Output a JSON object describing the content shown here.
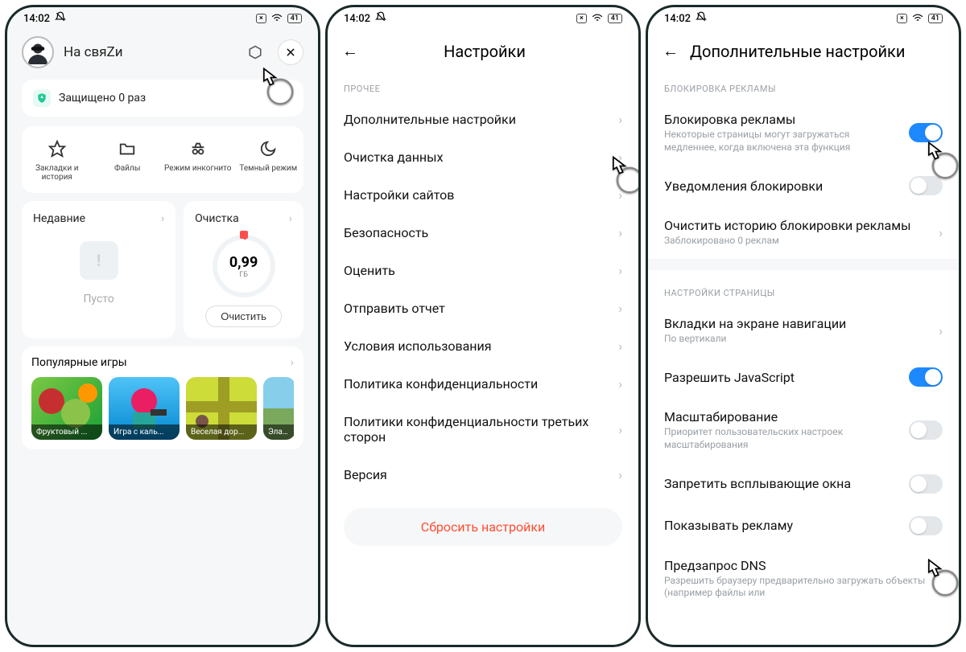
{
  "statusbar": {
    "time": "14:02",
    "battery": "41"
  },
  "phone1": {
    "username": "На свяZи",
    "protected": "Защищено 0 раз",
    "tiles": {
      "bookmarks": "Закладки и история",
      "files": "Файлы",
      "incognito": "Режим инкогнито",
      "dark": "Темный режим"
    },
    "recent": {
      "title": "Недавние",
      "empty": "Пусто"
    },
    "clean": {
      "title": "Очистка",
      "value": "0,99",
      "unit": "ГБ",
      "action": "Очистить"
    },
    "games": {
      "title": "Популярные игры",
      "items": [
        {
          "label": "Фруктовый ..."
        },
        {
          "label": "Игра с каль..."
        },
        {
          "label": "Веселая дор..."
        },
        {
          "label": "Элас..."
        }
      ]
    }
  },
  "phone2": {
    "title": "Настройки",
    "section": "ПРОЧЕЕ",
    "items": {
      "additional": "Дополнительные настройки",
      "clear_data": "Очистка данных",
      "site_settings": "Настройки сайтов",
      "security": "Безопасность",
      "rate": "Оценить",
      "report": "Отправить отчет",
      "terms": "Условия использования",
      "privacy": "Политика конфиденциальности",
      "third_party": "Политики конфиденциальности третьих сторон",
      "version": "Версия"
    },
    "reset": "Сбросить настройки"
  },
  "phone3": {
    "title": "Дополнительные настройки",
    "section_ads": "БЛОКИРОВКА РЕКЛАМЫ",
    "adblock": {
      "title": "Блокировка рекламы",
      "sub": "Некоторые страницы могут загружаться медленнее, когда включена эта функция"
    },
    "notif": "Уведомления блокировки",
    "clear_history": {
      "title": "Очистить историю блокировки рекламы",
      "sub": "Заблокировано 0 реклам"
    },
    "section_page": "НАСТРОЙКИ СТРАНИЦЫ",
    "tabs_nav": {
      "title": "Вкладки на экране навигации",
      "sub": "По вертикали"
    },
    "javascript": "Разрешить JavaScript",
    "zoom": {
      "title": "Масштабирование",
      "sub": "Приоритет пользовательских настроек масштабирования"
    },
    "popups": "Запретить всплывающие окна",
    "show_ads": "Показывать рекламу",
    "dns": {
      "title": "Предзапрос DNS",
      "sub": "Разрешить браузеру предварительно загружать объекты (например файлы или"
    }
  }
}
